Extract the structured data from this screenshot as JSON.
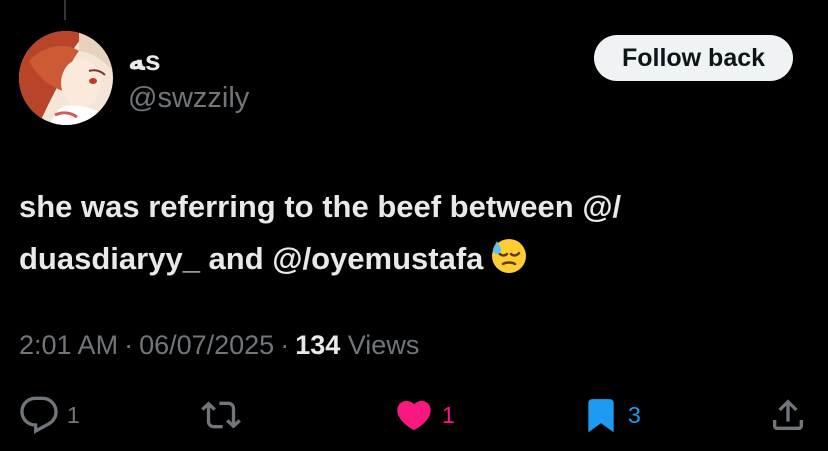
{
  "tweet": {
    "display_name": "ﻪs",
    "handle": "@swzzily",
    "follow_label": "Follow back",
    "text_line_1": "she was referring to the beef between @/",
    "text_line_2": "duasdiaryy_ and @/oyemustafa",
    "emoji": "downcast-face-with-sweat-emoji",
    "time": "2:01 AM",
    "date": "06/07/2025",
    "separator": "·",
    "views_count": "134",
    "views_label": "Views"
  },
  "actions": {
    "replies": {
      "icon": "reply-icon",
      "count": "1",
      "color": "#71767b"
    },
    "retweets": {
      "icon": "retweet-icon",
      "count": "",
      "color": "#71767b"
    },
    "likes": {
      "icon": "heart-icon",
      "count": "1",
      "color": "#f91880"
    },
    "bookmarks": {
      "icon": "bookmark-icon",
      "count": "3",
      "color": "#1d9bf0"
    },
    "share": {
      "icon": "share-icon",
      "color": "#71767b"
    }
  },
  "colors": {
    "background": "#000000",
    "text_primary": "#e7e9ea",
    "text_secondary": "#71767b",
    "like_active": "#f91880",
    "bookmark_active": "#1d9bf0",
    "button_bg": "#eff3f4"
  }
}
